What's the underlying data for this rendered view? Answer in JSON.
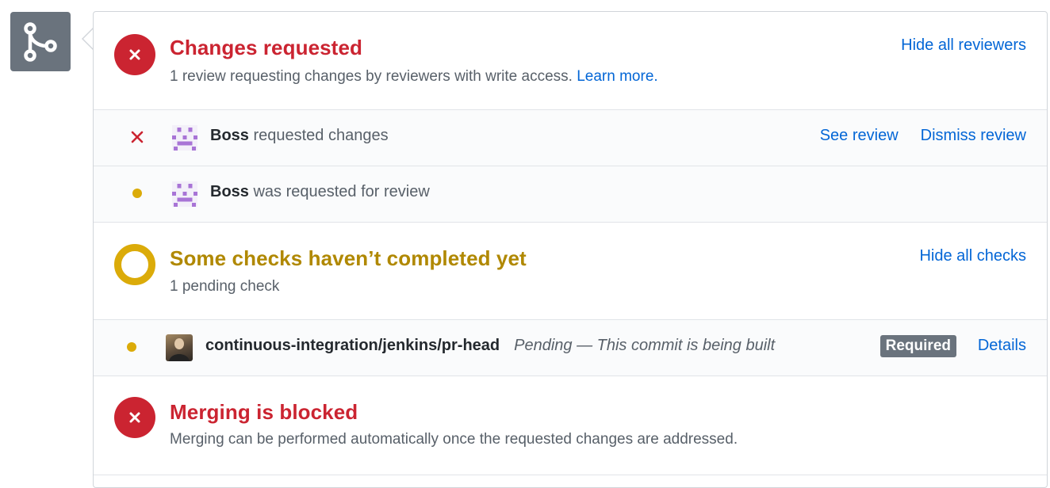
{
  "icons": {
    "merge": "git-merge-icon",
    "changes_requested": "x-circle-icon",
    "row_x": "x-icon",
    "pending_dot": "dot-icon",
    "checks_pending": "ring-icon",
    "merge_blocked": "x-circle-icon"
  },
  "colors": {
    "red": "#cb2431",
    "yellow": "#dbab09",
    "title_yellow": "#b08800",
    "link": "#0366d6",
    "muted": "#586069",
    "badge": "#6a737d",
    "row_bg": "#fafbfc"
  },
  "reviews": {
    "title": "Changes requested",
    "description": "1 review requesting changes by reviewers with write access.",
    "learn_more": "Learn more.",
    "toggle_label": "Hide all reviewers",
    "rows": [
      {
        "user": "Boss",
        "status_text": "requested changes",
        "see_review": "See review",
        "dismiss_review": "Dismiss review"
      },
      {
        "user": "Boss",
        "status_text": "was requested for review"
      }
    ]
  },
  "checks": {
    "title": "Some checks haven’t completed yet",
    "description": "1 pending check",
    "toggle_label": "Hide all checks",
    "rows": [
      {
        "name": "continuous-integration/jenkins/pr-head",
        "status": "Pending — This commit is being built",
        "badge": "Required",
        "details": "Details"
      }
    ]
  },
  "merge": {
    "title": "Merging is blocked",
    "description": "Merging can be performed automatically once the requested changes are addressed."
  }
}
